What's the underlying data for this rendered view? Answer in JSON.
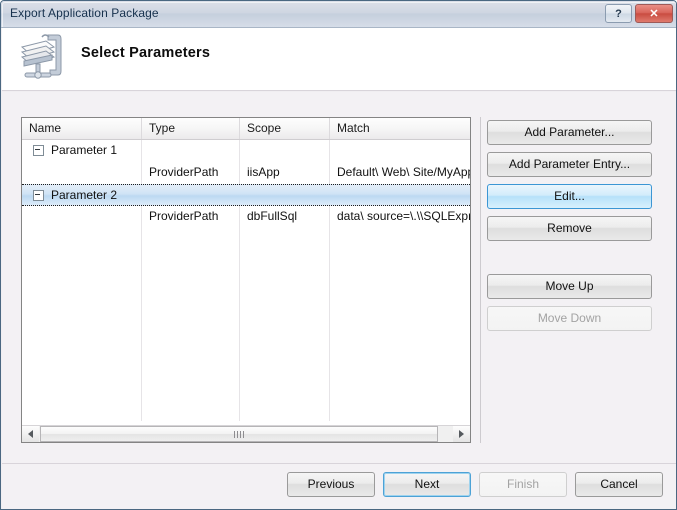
{
  "window": {
    "title": "Export Application Package",
    "help_button": "?",
    "close_button": "✕"
  },
  "header": {
    "title": "Select Parameters",
    "icon": "package-clamp-icon"
  },
  "grid": {
    "columns": [
      "Name",
      "Type",
      "Scope",
      "Match"
    ],
    "rows": [
      {
        "kind": "group",
        "expanded": true,
        "name": "Parameter 1",
        "type": "",
        "scope": "",
        "match": "",
        "selected": false
      },
      {
        "kind": "entry",
        "name": "",
        "type": "ProviderPath",
        "scope": "iisApp",
        "match": "Default\\ Web\\ Site/MyApp",
        "selected": false
      },
      {
        "kind": "group",
        "expanded": true,
        "name": "Parameter 2",
        "type": "",
        "scope": "",
        "match": "",
        "selected": true
      },
      {
        "kind": "entry",
        "name": "",
        "type": "ProviderPath",
        "scope": "dbFullSql",
        "match": "data\\ source=\\.\\\\SQLExpre",
        "selected": false
      }
    ],
    "scrollbar": {
      "left_arrow": "◄",
      "right_arrow": "►"
    }
  },
  "side_buttons": [
    {
      "label": "Add Parameter...",
      "state": "normal",
      "name": "add-parameter-button"
    },
    {
      "label": "Add Parameter Entry...",
      "state": "normal",
      "name": "add-parameter-entry-button"
    },
    {
      "label": "Edit...",
      "state": "hover",
      "name": "edit-button"
    },
    {
      "label": "Remove",
      "state": "normal",
      "name": "remove-button"
    },
    {
      "label": "Move Up",
      "state": "normal",
      "name": "move-up-button"
    },
    {
      "label": "Move Down",
      "state": "disabled",
      "name": "move-down-button"
    }
  ],
  "footer_buttons": [
    {
      "label": "Previous",
      "state": "normal",
      "name": "previous-button"
    },
    {
      "label": "Next",
      "state": "default",
      "name": "next-button"
    },
    {
      "label": "Finish",
      "state": "disabled",
      "name": "finish-button"
    },
    {
      "label": "Cancel",
      "state": "normal",
      "name": "cancel-button"
    }
  ],
  "colors": {
    "titlebar": "#cfd6e2",
    "close_button": "#d9665c",
    "selection": "#bcd9f2",
    "hover_accent": "#3c96d4",
    "content_background": "#f3f1f4"
  }
}
